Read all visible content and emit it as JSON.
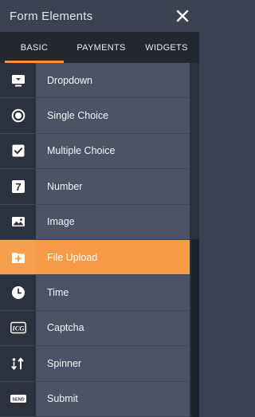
{
  "header": {
    "title": "Form Elements",
    "close_icon": "close-icon"
  },
  "tabs": [
    {
      "label": "BASIC",
      "active": true
    },
    {
      "label": "PAYMENTS",
      "active": false
    },
    {
      "label": "WIDGETS",
      "active": false
    }
  ],
  "items": [
    {
      "label": "Dropdown",
      "icon": "dropdown-icon"
    },
    {
      "label": "Single Choice",
      "icon": "radio-icon"
    },
    {
      "label": "Multiple Choice",
      "icon": "checkbox-icon"
    },
    {
      "label": "Number",
      "icon": "number-icon",
      "icon_text": "7"
    },
    {
      "label": "Image",
      "icon": "image-icon"
    },
    {
      "label": "File Upload",
      "icon": "folder-upload-icon",
      "active": true
    },
    {
      "label": "Time",
      "icon": "clock-icon"
    },
    {
      "label": "Captcha",
      "icon": "captcha-icon",
      "icon_text": "ICG"
    },
    {
      "label": "Spinner",
      "icon": "spinner-icon"
    },
    {
      "label": "Submit",
      "icon": "submit-icon",
      "icon_text": "SEND"
    }
  ],
  "colors": {
    "accent": "#f69a45",
    "header_bg": "#3b4352",
    "tabs_bg": "#232830",
    "row_bg": "#4b5366"
  }
}
